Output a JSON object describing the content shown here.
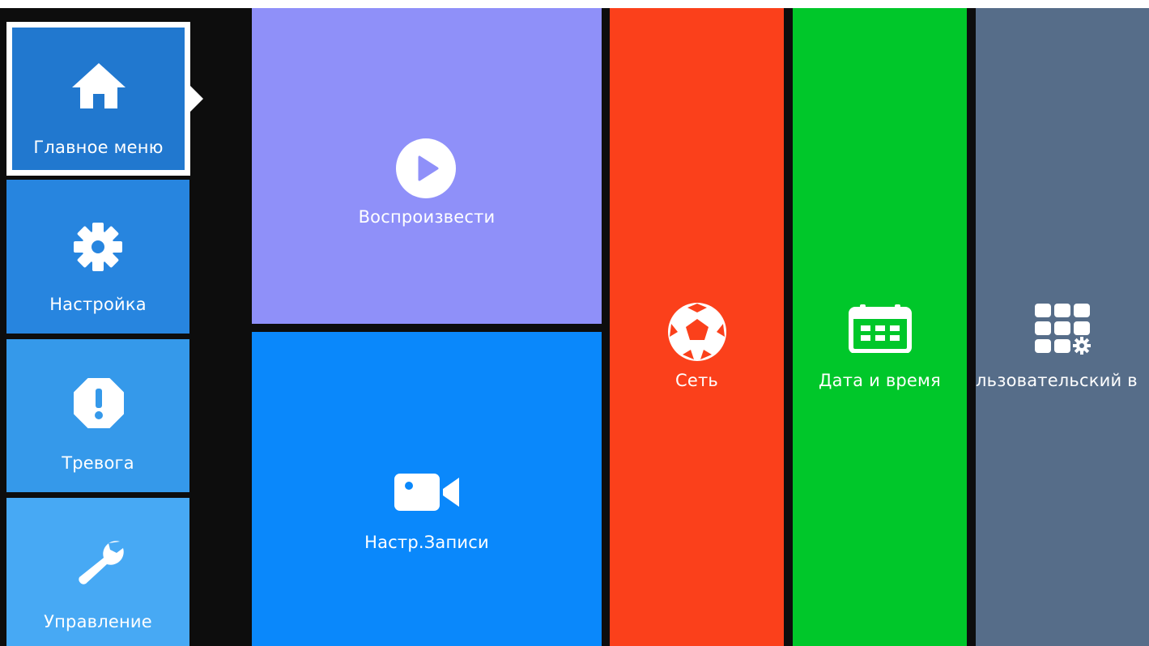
{
  "colors": {
    "background": "#0d0d0d",
    "sidebar_main": "#2178cf",
    "sidebar_settings": "#2785df",
    "sidebar_alarm": "#3599ea",
    "sidebar_manage": "#47a9f4",
    "tile_playback": "#8f90f9",
    "tile_record": "#0a88fb",
    "tile_network": "#fb401b",
    "tile_datetime": "#00c72a",
    "tile_custom": "#566d89",
    "text": "#ffffff"
  },
  "sidebar": {
    "selected": "main",
    "items": [
      {
        "id": "main",
        "label": "Главное меню",
        "icon": "home-icon"
      },
      {
        "id": "settings",
        "label": "Настройка",
        "icon": "gear-icon"
      },
      {
        "id": "alarm",
        "label": "Тревога",
        "icon": "alert-icon"
      },
      {
        "id": "manage",
        "label": "Управление",
        "icon": "wrench-icon"
      }
    ]
  },
  "tiles": {
    "playback": {
      "label": "Воспроизвести",
      "icon": "play-icon"
    },
    "record": {
      "label": "Настр.Записи",
      "icon": "video-camera-icon"
    },
    "network": {
      "label": "Сеть",
      "icon": "network-ball-icon"
    },
    "datetime": {
      "label": "Дата и время",
      "icon": "calendar-icon"
    },
    "custom": {
      "label": "льзовательский в",
      "icon": "grid-gear-icon"
    }
  }
}
